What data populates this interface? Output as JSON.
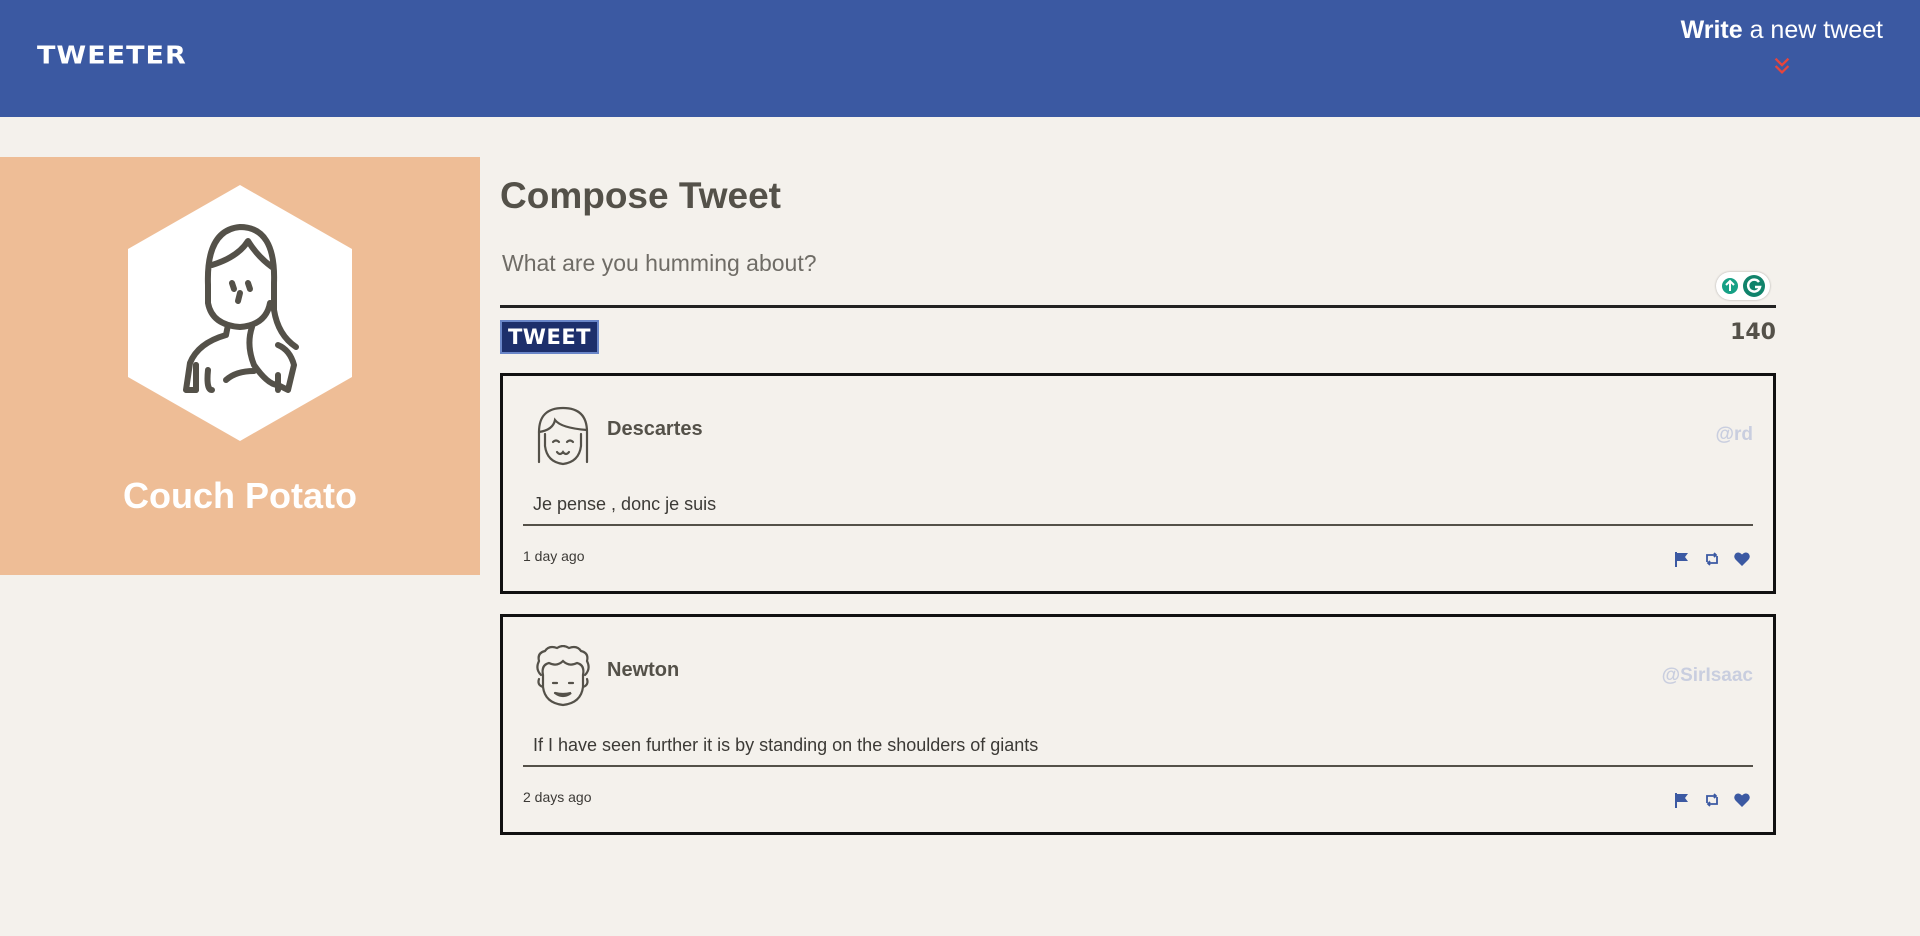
{
  "nav": {
    "brand": "TWEETER",
    "write_bold": "Write",
    "write_rest": " a new tweet",
    "chevron_color": "#e8453c",
    "icon": "double-chevron-down-icon"
  },
  "profile": {
    "name": "Couch Potato",
    "bg_color": "#eebd96",
    "avatar_icon": "woman-avatar-icon"
  },
  "compose": {
    "title": "Compose Tweet",
    "placeholder": "What are you humming about?",
    "button_label": "TWEET",
    "counter": "140"
  },
  "tweets": [
    {
      "name": "Descartes",
      "handle": "@rd",
      "text": "Je pense , donc je suis",
      "time": "1 day ago",
      "avatar_icon": "girl-avatar-icon"
    },
    {
      "name": "Newton",
      "handle": "@SirIsaac",
      "text": "If I have seen further it is by standing on the shoulders of giants",
      "time": "2 days ago",
      "avatar_icon": "curly-hair-avatar-icon"
    }
  ],
  "colors": {
    "nav": "#3b59a2",
    "background": "#f4f1ec",
    "text": "#545149",
    "button": "#1d2f6b",
    "action_icons": "#3b59a2",
    "handle": "#c9cedf"
  }
}
